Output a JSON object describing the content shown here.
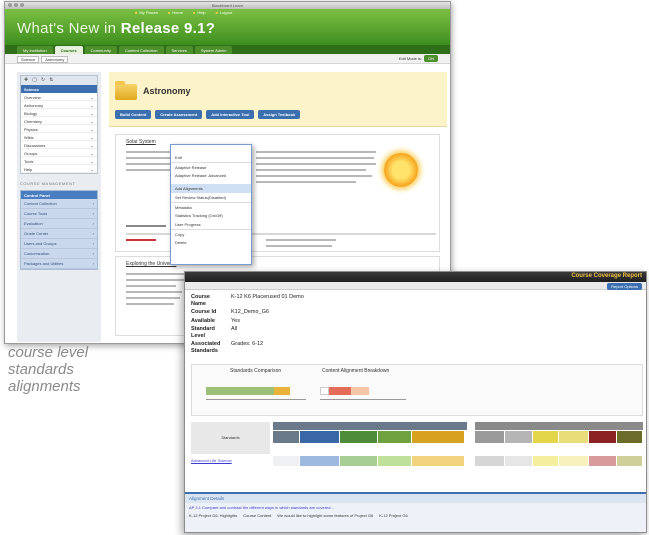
{
  "window1": {
    "title": "Blackboard Learn",
    "top_links": [
      "My Places",
      "Home",
      "Help",
      "Logout"
    ],
    "banner_prefix": "What's New in",
    "banner_bold": "Release 9.1?",
    "tabs": [
      "My Institution",
      "Courses",
      "Community",
      "Content Collection",
      "Services",
      "System Admin"
    ],
    "active_tab": 1,
    "breadcrumb": [
      "Science",
      "Astronomy"
    ],
    "edit_mode_label": "Edit Mode is:",
    "edit_mode_value": "ON",
    "course_menu": {
      "header": "Science",
      "items": [
        "Overview",
        "Astronomy",
        "Biology",
        "Chemistry",
        "Physics",
        "Wikis",
        "Discussions",
        "Groups",
        "Tools",
        "Help"
      ]
    },
    "management_label": "COURSE MANAGEMENT",
    "control_panel": {
      "header": "Control Panel",
      "items": [
        "Content Collection",
        "Course Tools",
        "Evaluation",
        "Grade Center",
        "Users and Groups",
        "Customization",
        "Packages and Utilities"
      ]
    },
    "content": {
      "title": "Astronomy",
      "buttons": [
        "Build Content",
        "Create Assessment",
        "Add Interactive Tool",
        "Assign Textbook"
      ],
      "item1_title": "Solar System",
      "item2_title": "Exploring the Universe"
    },
    "dropdown": {
      "items": [
        "Edit",
        "Adaptive Release",
        "Adaptive Release: Advanced",
        "Add Alignments",
        "Set Review Status(Disabled)",
        "Metadata",
        "Statistics Tracking (On/Off)",
        "User Progress",
        "Copy",
        "Delete"
      ],
      "highlighted": 3
    }
  },
  "caption": [
    "course level",
    "standards",
    "alignments"
  ],
  "window2": {
    "title": "Course Coverage Report",
    "select_button": "Report Options",
    "info": [
      {
        "key": "Course Name",
        "value": "K-12 K6 Placerused 01 Demo"
      },
      {
        "key": "Course Id",
        "value": "K12_Demo_G6"
      },
      {
        "key": "Available",
        "value": "Yes"
      },
      {
        "key": "Standard Level",
        "value": "All"
      },
      {
        "key": "Associated Standards",
        "value": "Grades: 6-12"
      }
    ],
    "chart_left_title": "Standards Comparison",
    "chart_right_title": "Content Alignment Breakdown",
    "table_header": "Standards",
    "table_row_label": "Advanced Life Science",
    "footer": {
      "title": "Alignment Details",
      "text": "AP 3.1 Compare and contrast the different ways in which standards are covered...",
      "row": [
        "K-12 Project G6: Highlights",
        "Course Content",
        "We would like to highlight some features of Project G6",
        "K-12 Project G6"
      ]
    }
  },
  "colors": {
    "green_header": "#4a9a28",
    "blue_accent": "#3b6fb0",
    "caption_gray": "#8a8a8a",
    "report_title_gold": "#f0c040"
  }
}
